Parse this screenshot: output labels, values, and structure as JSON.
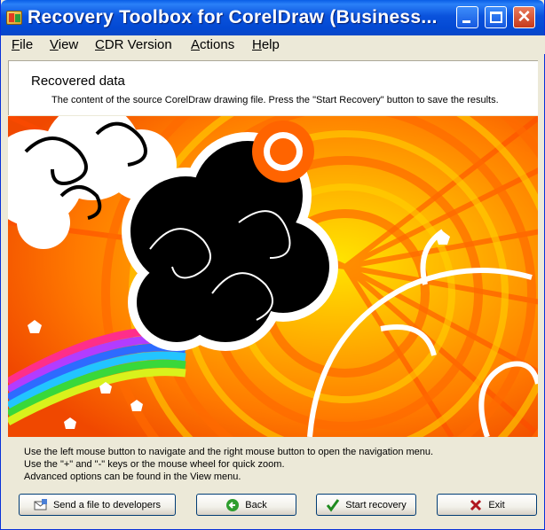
{
  "window": {
    "title": "Recovery Toolbox for CorelDraw (Business...",
    "controls": {
      "minimize": "minimize-icon",
      "maximize": "maximize-icon",
      "close": "close-icon"
    }
  },
  "menu": [
    {
      "label": "File",
      "accel": "F",
      "rest": "ile"
    },
    {
      "label": "View",
      "accel": "V",
      "rest": "iew"
    },
    {
      "label": "CDR Version",
      "accel": "C",
      "rest": "DR Version"
    },
    {
      "label": "Actions",
      "accel": "A",
      "rest": "ctions"
    },
    {
      "label": "Help",
      "accel": "H",
      "rest": "elp"
    }
  ],
  "header": {
    "title": "Recovered data",
    "description": "The content of the source CorelDraw drawing file. Press the \"Start Recovery\" button to save the results."
  },
  "hints": [
    "Use the left mouse button to navigate and the right mouse button to open the navigation menu.",
    "Use the \"+\" and \"-\" keys or the mouse wheel for quick zoom.",
    "Advanced options can be found in the View menu."
  ],
  "buttons": {
    "send": {
      "label": "Send a file to developers",
      "icon": "send-file-icon"
    },
    "back": {
      "label": "Back",
      "icon": "back-arrow-icon"
    },
    "start": {
      "label": "Start recovery",
      "icon": "checkmark-icon"
    },
    "exit": {
      "label": "Exit",
      "icon": "x-icon"
    }
  },
  "colors": {
    "titlebar": "#0a52dc",
    "face": "#ece9d8",
    "accent_green": "#2e9e2e",
    "accent_red": "#b0171f"
  }
}
